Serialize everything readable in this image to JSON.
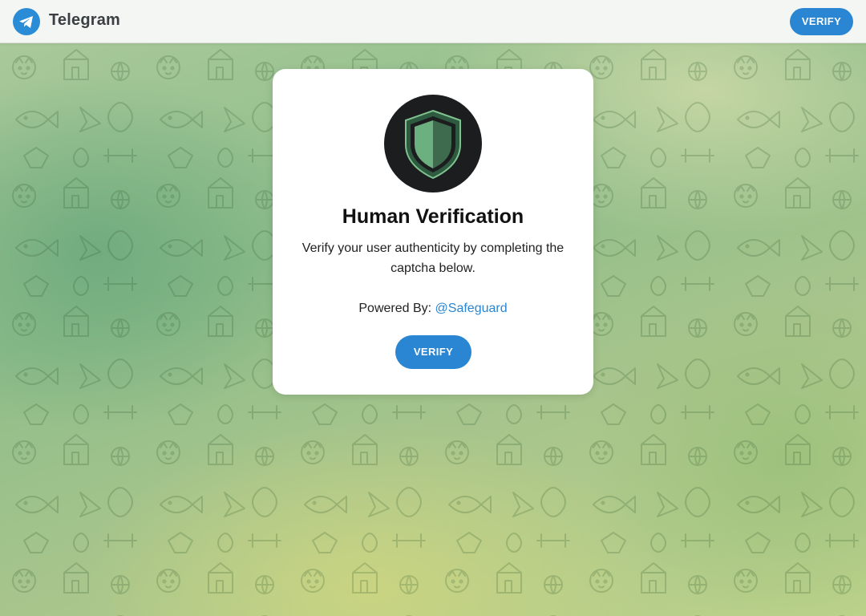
{
  "header": {
    "app_name": "Telegram",
    "verify_label": "VERIFY"
  },
  "card": {
    "title": "Human Verification",
    "description": "Verify your user authenticity by completing the captcha below.",
    "powered_by_label": "Powered By:",
    "powered_by_link": "@Safeguard",
    "verify_label": "VERIFY"
  },
  "colors": {
    "accent": "#2a86d2",
    "logo_blue": "#2a8bd6",
    "shield_green": "#5a9e6f",
    "shield_dark": "#2e5a3f",
    "shield_circle": "#1c1d1f"
  },
  "icons": {
    "logo": "telegram-paper-plane-icon",
    "shield": "shield-icon"
  }
}
